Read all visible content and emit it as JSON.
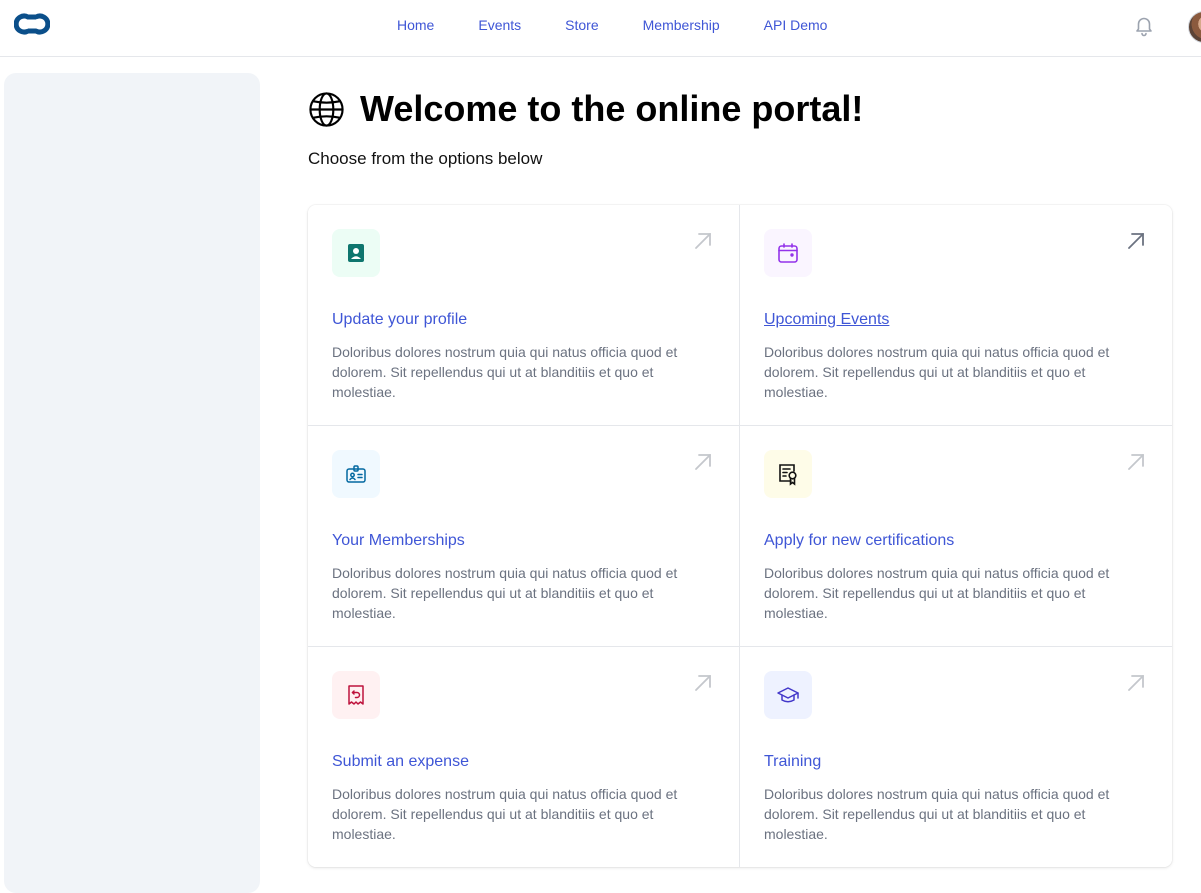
{
  "nav": {
    "items": [
      {
        "label": "Home"
      },
      {
        "label": "Events"
      },
      {
        "label": "Store"
      },
      {
        "label": "Membership"
      },
      {
        "label": "API Demo"
      }
    ]
  },
  "header": {
    "title": "Welcome to the online portal!",
    "subtitle": "Choose from the options below"
  },
  "cards": [
    {
      "title": "Update your profile",
      "description": "Doloribus dolores nostrum quia qui natus officia quod et dolorem. Sit repellendus qui ut at blanditiis et quo et molestiae.",
      "icon": "profile-icon",
      "icon_bg": "#ecfdf5",
      "icon_color": "#0f766e"
    },
    {
      "title": "Upcoming Events",
      "description": "Doloribus dolores nostrum quia qui natus officia quod et dolorem. Sit repellendus qui ut at blanditiis et quo et molestiae.",
      "icon": "calendar-icon",
      "icon_bg": "#faf5ff",
      "icon_color": "#9333ea"
    },
    {
      "title": "Your Memberships",
      "description": "Doloribus dolores nostrum quia qui natus officia quod et dolorem. Sit repellendus qui ut at blanditiis et quo et molestiae.",
      "icon": "id-badge-icon",
      "icon_bg": "#f0f9ff",
      "icon_color": "#0369a1"
    },
    {
      "title": "Apply for new certifications",
      "description": "Doloribus dolores nostrum quia qui natus officia quod et dolorem. Sit repellendus qui ut at blanditiis et quo et molestiae.",
      "icon": "certificate-icon",
      "icon_bg": "#fefce8",
      "icon_color": "#111111"
    },
    {
      "title": "Submit an expense",
      "description": "Doloribus dolores nostrum quia qui natus officia quod et dolorem. Sit repellendus qui ut at blanditiis et quo et molestiae.",
      "icon": "receipt-refund-icon",
      "icon_bg": "#fff1f2",
      "icon_color": "#be123c"
    },
    {
      "title": "Training",
      "description": "Doloribus dolores nostrum quia qui natus officia quod et dolorem. Sit repellendus qui ut at blanditiis et quo et molestiae.",
      "icon": "graduation-cap-icon",
      "icon_bg": "#eef2ff",
      "icon_color": "#4338ca"
    }
  ],
  "colors": {
    "link": "#3f56d6",
    "sidebar_bg": "#f1f4f8",
    "text_muted": "#6b7280",
    "logo": "#0b4f8a"
  }
}
